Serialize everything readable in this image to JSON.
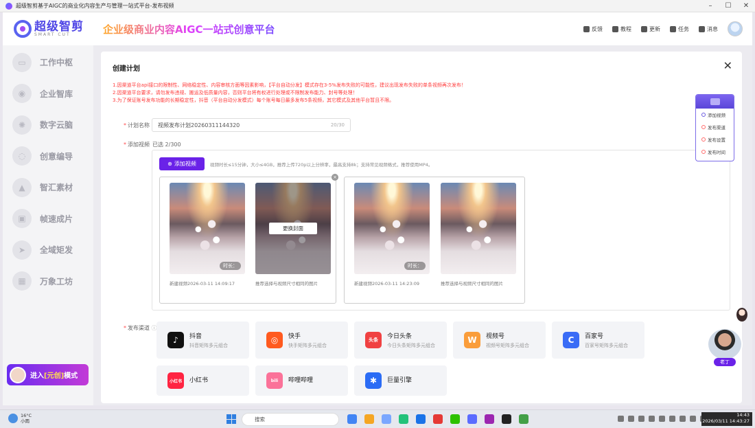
{
  "window": {
    "title": "超级智剪基于AIGC的商业化内容生产与管理一站式平台-发布视频",
    "minimize": "–",
    "maximize": "☐",
    "close": "✕"
  },
  "header": {
    "logo_cn": "超级智剪",
    "logo_en": "SMART CUT",
    "slogan": "企业级商业内容AIGC一站式创意平台",
    "actions": [
      {
        "label": "反馈",
        "icon": "feedback-icon"
      },
      {
        "label": "教程",
        "icon": "book-icon"
      },
      {
        "label": "更新",
        "icon": "refresh-icon"
      },
      {
        "label": "任务",
        "icon": "task-icon"
      },
      {
        "label": "消息",
        "icon": "bell-icon"
      }
    ]
  },
  "sidebar": {
    "items": [
      {
        "label": "工作中枢",
        "icon": "monitor-icon"
      },
      {
        "label": "企业智库",
        "icon": "bulb-icon"
      },
      {
        "label": "数字云脑",
        "icon": "brain-icon"
      },
      {
        "label": "创意编导",
        "icon": "idea-icon"
      },
      {
        "label": "智汇素材",
        "icon": "image-icon"
      },
      {
        "label": "帧速成片",
        "icon": "film-icon"
      },
      {
        "label": "全域矩发",
        "icon": "send-icon"
      },
      {
        "label": "万象工坊",
        "icon": "grid-icon"
      }
    ],
    "enter": {
      "pre": "进入",
      "highlight": "[元创]",
      "post": "模式"
    }
  },
  "dialog": {
    "title": "创建计划",
    "close": "✕",
    "notes": [
      "1.因渠道平台api接口的限制性、网络稳定性、内容审核方面等因素影响，【平台自动分发】模式存在3-5%发布失败的可能性，建议出现发布失败的单条视频再次发布！",
      "2.因渠道平台要求，请勿发布违规、搬运及低质量内容，否则平台将有权进行处理或不限制发布能力、封号等处理！",
      "3.为了保证账号发布功能的长期稳定性，抖音（平台自动分发模式）每个账号每日最多发布5条视频，其它模式及其他平台暂且不限。"
    ],
    "plan_label": "计划名称",
    "plan_value": "视频发布计划20260311144320",
    "plan_count": "20/30",
    "video_label": "添加视频",
    "selected_text": "已选 2/300",
    "add_button": "添加视频",
    "add_tip": "视频时长≤15分钟，大小≤4GB，推荐上传720p以上分辨率，最高支持8k；支持常见视频格式，推荐使用MP4。",
    "groups": [
      {
        "cards": [
          {
            "duration": "时长：",
            "caption": "新建视频2026-03-11 14:09:17",
            "dim": false
          },
          {
            "duration": "",
            "caption": "推荐选择与视频尺寸相同的图片",
            "dim": true,
            "cover_btn": "更换封面"
          }
        ]
      },
      {
        "cards": [
          {
            "duration": "时长：",
            "caption": "新建视频2026-03-11 14:23:09",
            "dim": false
          },
          {
            "duration": "",
            "caption": "推荐选择与视频尺寸相同的图片",
            "dim": false
          }
        ]
      }
    ],
    "channels_label": "发布渠道",
    "channels": [
      {
        "name": "抖音",
        "sub": "抖音矩阵多元组合",
        "color": "#111111",
        "glyph": "♪",
        "icon": "douyin-icon"
      },
      {
        "name": "快手",
        "sub": "快手矩阵多元组合",
        "color": "#ff5a1f",
        "glyph": "◎",
        "icon": "kuaishou-icon"
      },
      {
        "name": "今日头条",
        "sub": "今日头条矩阵多元组合",
        "color": "#f04142",
        "glyph": "头条",
        "icon": "toutiao-icon"
      },
      {
        "name": "视频号",
        "sub": "视频号矩阵多元组合",
        "color": "#fa9d3b",
        "glyph": "W",
        "icon": "shipinhao-icon"
      },
      {
        "name": "百家号",
        "sub": "百家号矩阵多元组合",
        "color": "#3a6cf6",
        "glyph": "C",
        "icon": "baijiahao-icon"
      },
      {
        "name": "小红书",
        "sub": "",
        "color": "#ff2442",
        "glyph": "小红书",
        "icon": "xiaohongshu-icon"
      },
      {
        "name": "哔哩哔哩",
        "sub": "",
        "color": "#fb7299",
        "glyph": "bili",
        "icon": "bilibili-icon"
      },
      {
        "name": "巨量引擎",
        "sub": "",
        "color": "#2b6cf5",
        "glyph": "✱",
        "icon": "juliang-icon"
      }
    ]
  },
  "steps": [
    {
      "label": "添加视频",
      "done": true
    },
    {
      "label": "发布渠道",
      "done": false
    },
    {
      "label": "发布设置",
      "done": false
    },
    {
      "label": "发布时间",
      "done": false
    }
  ],
  "assistant": {
    "tag": "老丁"
  },
  "taskbar": {
    "temp": "16°C",
    "weather": "小雨",
    "search": "搜索",
    "time": "14:43",
    "datetime": "2026/03/11 14:43:27"
  }
}
